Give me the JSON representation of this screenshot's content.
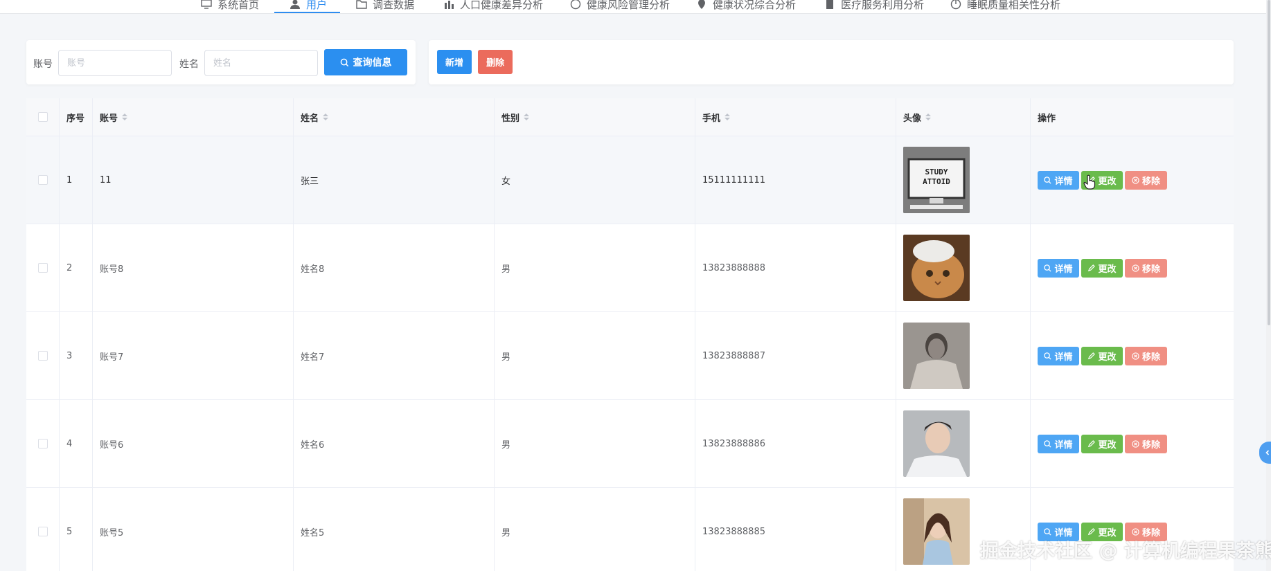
{
  "nav": {
    "items": [
      {
        "label": "系统首页",
        "icon": "monitor-icon"
      },
      {
        "label": "用户",
        "icon": "user-icon",
        "active": true
      },
      {
        "label": "调查数据",
        "icon": "folder-icon"
      },
      {
        "label": "人口健康差异分析",
        "icon": "bar-chart-icon"
      },
      {
        "label": "健康风险管理分析",
        "icon": "info-icon"
      },
      {
        "label": "健康状况综合分析",
        "icon": "location-icon"
      },
      {
        "label": "医疗服务利用分析",
        "icon": "document-icon"
      },
      {
        "label": "睡眠质量相关性分析",
        "icon": "pie-icon"
      }
    ]
  },
  "search": {
    "account_label": "账号",
    "account_placeholder": "账号",
    "name_label": "姓名",
    "name_placeholder": "姓名",
    "search_button": "查询信息"
  },
  "actions": {
    "add_button": "新增",
    "delete_button": "删除"
  },
  "table": {
    "headers": {
      "index": "序号",
      "account": "账号",
      "name": "姓名",
      "gender": "性别",
      "phone": "手机",
      "avatar": "头像",
      "operations": "操作"
    },
    "rows": [
      {
        "index": "1",
        "account": "11",
        "name": "张三",
        "gender": "女",
        "phone": "15111111111",
        "avatar": "study-poster-image"
      },
      {
        "index": "2",
        "account": "账号8",
        "name": "姓名8",
        "gender": "男",
        "phone": "13823888888",
        "avatar": "cat-image"
      },
      {
        "index": "3",
        "account": "账号7",
        "name": "姓名7",
        "gender": "男",
        "phone": "13823888887",
        "avatar": "man-bw-image"
      },
      {
        "index": "4",
        "account": "账号6",
        "name": "姓名6",
        "gender": "男",
        "phone": "13823888886",
        "avatar": "man-portrait-image"
      },
      {
        "index": "5",
        "account": "账号5",
        "name": "姓名5",
        "gender": "男",
        "phone": "13823888885",
        "avatar": "woman-portrait-image"
      }
    ],
    "ops": {
      "detail": "详情",
      "edit": "更改",
      "remove": "移除"
    }
  },
  "watermark": "掘金技术社区 @ 计算机编程果茶熊",
  "colors": {
    "primary": "#2b8ff0",
    "danger": "#eb6b5c",
    "success": "#6abb4c",
    "detail": "#4ea6f4",
    "remove": "#f08f83"
  }
}
